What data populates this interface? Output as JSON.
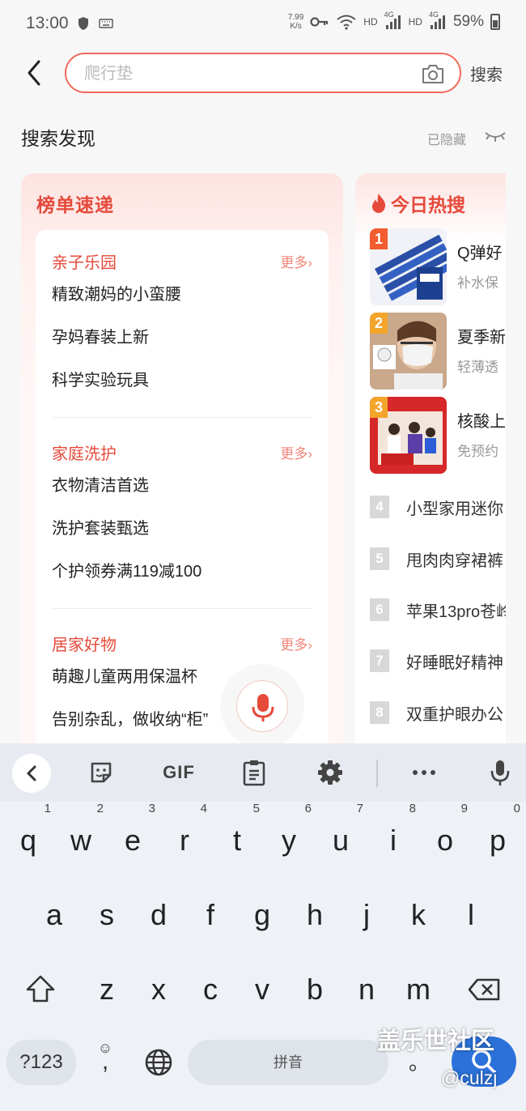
{
  "status_bar": {
    "time": "13:00",
    "net_speed_top": "7.99",
    "net_speed_bottom": "K/s",
    "hd1": "HD",
    "signal1": "4G",
    "hd2": "HD",
    "signal2": "4G",
    "battery": "59%"
  },
  "search": {
    "placeholder": "爬行垫",
    "submit_label": "搜索"
  },
  "discover": {
    "title": "搜索发现",
    "hidden_label": "已隐藏"
  },
  "rank_card": {
    "title": "榜单速递",
    "sections": [
      {
        "title": "亲子乐园",
        "more": "更多›",
        "items": [
          "精致潮妈的小蛮腰",
          "孕妈春装上新",
          "科学实验玩具"
        ]
      },
      {
        "title": "家庭洗护",
        "more": "更多›",
        "items": [
          "衣物清洁首选",
          "洗护套装甄选",
          "个护领券满119减100"
        ]
      },
      {
        "title": "居家好物",
        "more": "更多›",
        "items": [
          "萌趣儿童两用保温杯",
          "告别杂乱，做收纳“柜”"
        ]
      }
    ]
  },
  "hot_card": {
    "title": "今日热搜",
    "top_items": [
      {
        "rank": "1",
        "line1": "Q弹好",
        "line2": "补水保",
        "badge_color": "#f25c2e"
      },
      {
        "rank": "2",
        "line1": "夏季新",
        "line2": "轻薄透",
        "badge_color": "#f3a42a"
      },
      {
        "rank": "3",
        "line1": "核酸上",
        "line2": "免预约",
        "badge_color": "#f3a42a"
      }
    ],
    "items": [
      {
        "rank": "4",
        "text": "小型家用迷你"
      },
      {
        "rank": "5",
        "text": "甩肉肉穿裙裤"
      },
      {
        "rank": "6",
        "text": "苹果13pro苍岭"
      },
      {
        "rank": "7",
        "text": "好睡眠好精神"
      },
      {
        "rank": "8",
        "text": "双重护眼办公"
      }
    ]
  },
  "keyboard": {
    "toolbar": [
      "collapse-icon",
      "sticker-icon",
      "GIF",
      "clipboard-icon",
      "settings-icon",
      "more-icon",
      "mic-icon"
    ],
    "row1": [
      {
        "ch": "q",
        "hint": "1"
      },
      {
        "ch": "w",
        "hint": "2"
      },
      {
        "ch": "e",
        "hint": "3"
      },
      {
        "ch": "r",
        "hint": "4"
      },
      {
        "ch": "t",
        "hint": "5"
      },
      {
        "ch": "y",
        "hint": "6"
      },
      {
        "ch": "u",
        "hint": "7"
      },
      {
        "ch": "i",
        "hint": "8"
      },
      {
        "ch": "o",
        "hint": "9"
      },
      {
        "ch": "p",
        "hint": "0"
      }
    ],
    "row2": [
      "a",
      "s",
      "d",
      "f",
      "g",
      "h",
      "j",
      "k",
      "l"
    ],
    "row3": [
      "z",
      "x",
      "c",
      "v",
      "b",
      "n",
      "m"
    ],
    "symbols_key": "?123",
    "emoji_comma_hint": "☺",
    "comma": ",",
    "space_label": "拼音",
    "period": "。"
  },
  "watermark": {
    "line1": "盖乐世社区",
    "line2": "@culzj"
  },
  "colors": {
    "accent": "#e64a3b",
    "search_border": "#f1695a",
    "enter_key": "#2b71d9"
  }
}
